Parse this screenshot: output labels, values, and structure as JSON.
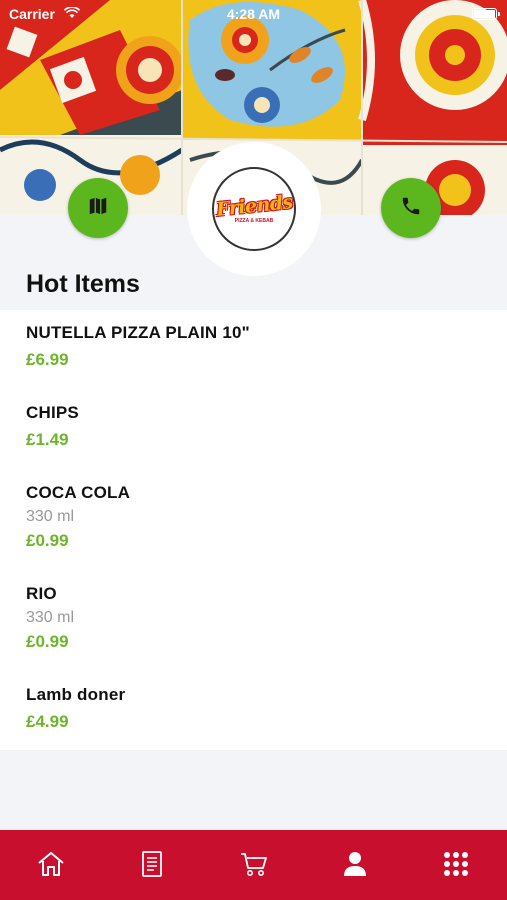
{
  "status_bar": {
    "carrier": "Carrier",
    "time": "4:28 AM"
  },
  "header": {
    "logo_text": "Friends",
    "logo_subtext": "PIZZA & KEBAB",
    "map_button_icon": "map-icon",
    "call_button_icon": "phone-icon"
  },
  "section": {
    "title": "Hot Items"
  },
  "items": [
    {
      "name": "NUTELLA PIZZA PLAIN 10\"",
      "desc": "",
      "price": "£6.99"
    },
    {
      "name": "CHIPS",
      "desc": "",
      "price": "£1.49"
    },
    {
      "name": "COCA COLA",
      "desc": "330 ml",
      "price": "£0.99"
    },
    {
      "name": "RIO",
      "desc": "330 ml",
      "price": "£0.99"
    },
    {
      "name": "Lamb doner",
      "desc": "",
      "price": "£4.99"
    }
  ],
  "tab_bar": {
    "tabs": [
      {
        "icon": "home-icon"
      },
      {
        "icon": "menu-icon"
      },
      {
        "icon": "cart-icon"
      },
      {
        "icon": "profile-icon"
      },
      {
        "icon": "more-grid-icon"
      }
    ]
  },
  "colors": {
    "accent_green": "#5cb61e",
    "price_green": "#6cb52c",
    "brand_red": "#c8102e",
    "background": "#f2f4f7"
  }
}
